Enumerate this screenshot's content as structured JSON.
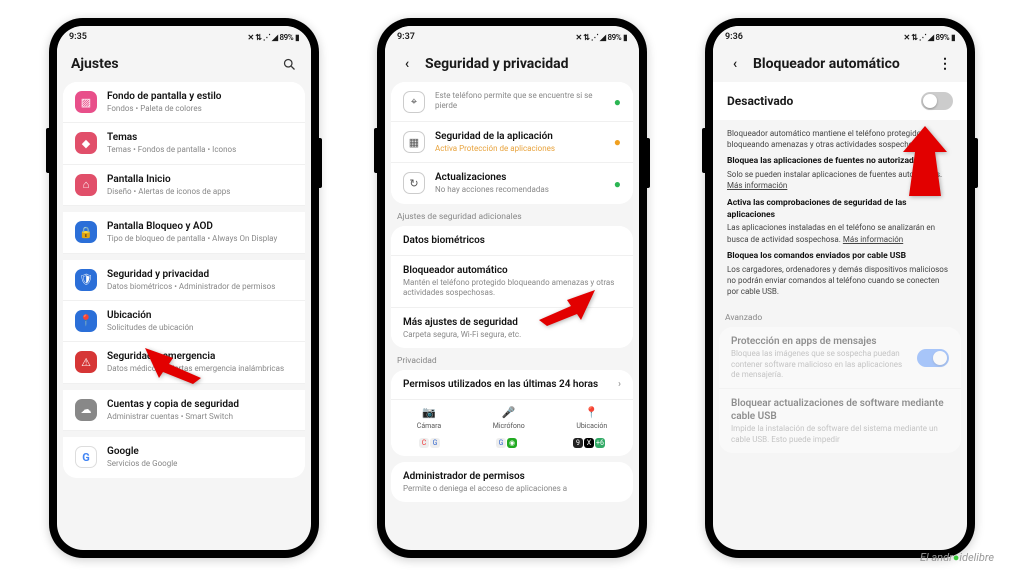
{
  "statusbar": {
    "time1": "9:35",
    "time2": "9:37",
    "time3": "9:36",
    "battery": "89%",
    "icons": "✕ ⇅ ⋰ ◢"
  },
  "phone1": {
    "title": "Ajustes",
    "rows": [
      {
        "icon": "▨",
        "bg": "#e84f8a",
        "title": "Fondo de pantalla y estilo",
        "sub": "Fondos • Paleta de colores"
      },
      {
        "icon": "◆",
        "bg": "#e14f6a",
        "title": "Temas",
        "sub": "Temas • Fondos de pantalla • Iconos"
      },
      {
        "icon": "⌂",
        "bg": "#e14f6a",
        "title": "Pantalla Inicio",
        "sub": "Diseño • Alertas de iconos de apps"
      },
      {
        "icon": "🔒",
        "bg": "#2b6fd8",
        "title": "Pantalla Bloqueo y AOD",
        "sub": "Tipo de bloqueo de pantalla • Always On Display"
      },
      {
        "icon": "🛡",
        "bg": "#2b6fd8",
        "title": "Seguridad y privacidad",
        "sub": "Datos biométricos • Administrador de permisos"
      },
      {
        "icon": "📍",
        "bg": "#2b6fd8",
        "title": "Ubicación",
        "sub": "Solicitudes de ubicación"
      },
      {
        "icon": "⚠",
        "bg": "#d63636",
        "title": "Seguridad y emergencia",
        "sub": "Datos médicos • Alertas emergencia inalámbricas"
      },
      {
        "icon": "☁",
        "bg": "#888",
        "title": "Cuentas y copia de seguridad",
        "sub": "Administrar cuentas • Smart Switch"
      },
      {
        "icon": "G",
        "bg": "#fff",
        "title": "Google",
        "sub": "Servicios de Google"
      }
    ]
  },
  "phone2": {
    "title": "Seguridad y privacidad",
    "top": [
      {
        "icon": "⌖",
        "title": "",
        "sub": "Este teléfono permite que se encuentre si se pierde",
        "status": "ok"
      },
      {
        "icon": "▦",
        "title": "Seguridad de la aplicación",
        "sub": "Activa Protección de aplicaciones",
        "status": "warn",
        "warn": true
      },
      {
        "icon": "↻",
        "title": "Actualizaciones",
        "sub": "No hay acciones recomendadas",
        "status": "ok"
      }
    ],
    "section1": "Ajustes de seguridad adicionales",
    "mid": [
      {
        "title": "Datos biométricos",
        "sub": ""
      },
      {
        "title": "Bloqueador automático",
        "sub": "Mantén el teléfono protegido bloqueando amenazas y otras actividades sospechosas."
      },
      {
        "title": "Más ajustes de seguridad",
        "sub": "Carpeta segura, Wi-Fi segura, etc."
      }
    ],
    "section2": "Privacidad",
    "perm_title": "Permisos utilizados en las últimas 24 horas",
    "perms": [
      {
        "label": "Cámara",
        "icon": "📷"
      },
      {
        "label": "Micrófono",
        "icon": "🎤"
      },
      {
        "label": "Ubicación",
        "icon": "📍"
      }
    ],
    "admin": {
      "title": "Administrador de permisos",
      "sub": "Permite o deniega el acceso de aplicaciones a"
    }
  },
  "phone3": {
    "title": "Bloqueador automático",
    "toggle": "Desactivado",
    "info_intro": "Bloqueador automático mantiene el teléfono protegido bloqueando amenazas y otras actividades sospechosas.",
    "b1_title": "Bloquea las aplicaciones de fuentes no autorizadas",
    "b1_text": "Solo se pueden instalar aplicaciones de fuentes autorizadas.",
    "b2_title": "Activa las comprobaciones de seguridad de las aplicaciones",
    "b2_text": "Las aplicaciones instaladas en el teléfono se analizarán en busca de actividad sospechosa.",
    "b3_title": "Bloquea los comandos enviados por cable USB",
    "b3_text": "Los cargadores, ordenadores y demás dispositivos maliciosos no podrán enviar comandos al teléfono cuando se conecten por cable USB.",
    "more": "Más información",
    "advanced": "Avanzado",
    "adv1_title": "Protección en apps de mensajes",
    "adv1_text": "Bloquea las imágenes que se sospecha puedan contener software malicioso en las aplicaciones de mensajería.",
    "adv2_title": "Bloquear actualizaciones de software mediante cable USB",
    "adv2_text": "Impide la instalación de software del sistema mediante un cable USB. Esto puede impedir"
  },
  "watermark": "El androidelibre"
}
